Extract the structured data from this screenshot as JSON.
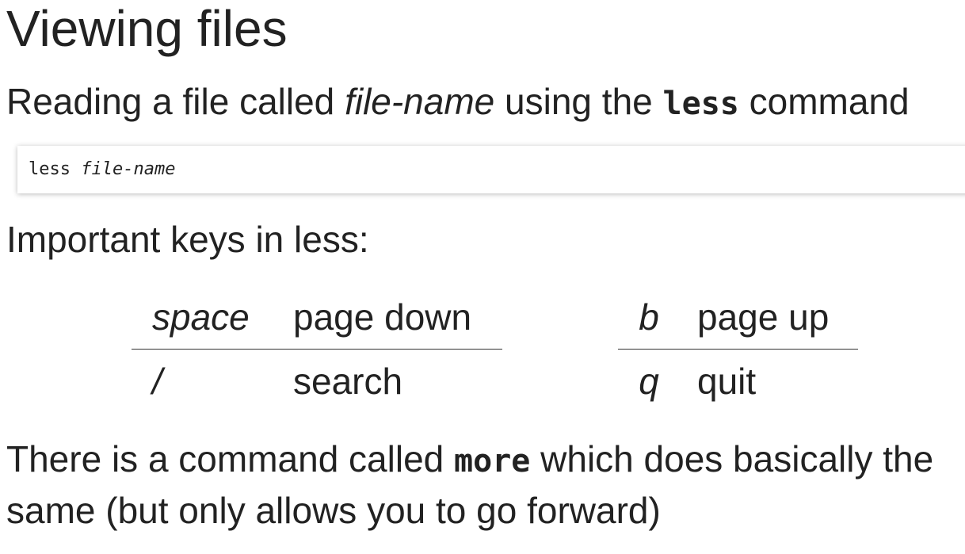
{
  "title": "Viewing files",
  "intro": {
    "part1": "Reading a file called ",
    "filename": "file-name",
    "part2": " using the ",
    "command": "less",
    "part3": " command"
  },
  "code_example": {
    "command": "less ",
    "argument": "file-name"
  },
  "keys_heading": "Important keys in less:",
  "keys_left": [
    {
      "key": "space",
      "action": "page down"
    },
    {
      "key": "/",
      "action": "search"
    }
  ],
  "keys_right": [
    {
      "key": "b",
      "action": "page up"
    },
    {
      "key": "q",
      "action": "quit"
    }
  ],
  "outro": {
    "part1": "There is a command called ",
    "command": "more",
    "part2": " which does basically the same (but only allows you to go forward)"
  }
}
